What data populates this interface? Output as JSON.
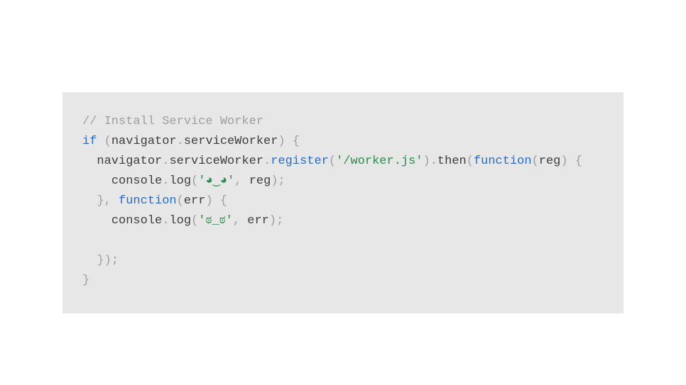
{
  "code": {
    "l1": {
      "comment": "// Install Service Worker"
    },
    "l2": {
      "kw_if": "if",
      "sp1": " ",
      "p1": "(",
      "nav": "navigator",
      "dot1": ".",
      "sw": "serviceWorker",
      "p2": ")",
      "sp2": " ",
      "brace": "{"
    },
    "l3": {
      "indent": "  ",
      "nav": "navigator",
      "dot1": ".",
      "sw": "serviceWorker",
      "dot2": ".",
      "reg": "register",
      "p1": "(",
      "str": "'/worker.js'",
      "p2": ")",
      "dot3": ".",
      "then": "then",
      "p3": "(",
      "fn": "function",
      "p4": "(",
      "arg": "reg",
      "p5": ")",
      "sp": " ",
      "brace": "{"
    },
    "l4": {
      "indent": "    ",
      "console": "console",
      "dot": ".",
      "log": "log",
      "p1": "(",
      "str": "'◕‿◕'",
      "comma": ",",
      "sp": " ",
      "arg": "reg",
      "p2": ")",
      "semi": ";"
    },
    "l5": {
      "indent": "  ",
      "brace": "}",
      "comma": ",",
      "sp": " ",
      "fn": "function",
      "p1": "(",
      "arg": "err",
      "p2": ")",
      "sp2": " ",
      "brace2": "{"
    },
    "l6": {
      "indent": "    ",
      "console": "console",
      "dot": ".",
      "log": "log",
      "p1": "(",
      "str": "'ಠ_ಠ'",
      "comma": ",",
      "sp": " ",
      "arg": "err",
      "p2": ")",
      "semi": ";"
    },
    "l7": {
      "indent": "  ",
      "brace": "}",
      "p": ")",
      "semi": ";"
    },
    "l8": {
      "brace": "}"
    }
  }
}
